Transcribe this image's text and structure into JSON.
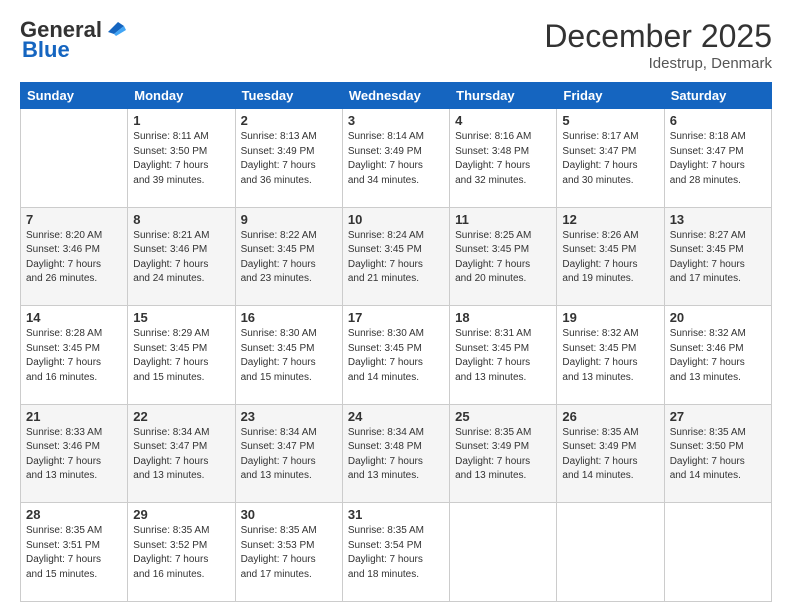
{
  "logo": {
    "general": "General",
    "blue": "Blue"
  },
  "header": {
    "month": "December 2025",
    "location": "Idestrup, Denmark"
  },
  "days": [
    "Sunday",
    "Monday",
    "Tuesday",
    "Wednesday",
    "Thursday",
    "Friday",
    "Saturday"
  ],
  "weeks": [
    [
      {
        "num": "",
        "info": ""
      },
      {
        "num": "1",
        "info": "Sunrise: 8:11 AM\nSunset: 3:50 PM\nDaylight: 7 hours\nand 39 minutes."
      },
      {
        "num": "2",
        "info": "Sunrise: 8:13 AM\nSunset: 3:49 PM\nDaylight: 7 hours\nand 36 minutes."
      },
      {
        "num": "3",
        "info": "Sunrise: 8:14 AM\nSunset: 3:49 PM\nDaylight: 7 hours\nand 34 minutes."
      },
      {
        "num": "4",
        "info": "Sunrise: 8:16 AM\nSunset: 3:48 PM\nDaylight: 7 hours\nand 32 minutes."
      },
      {
        "num": "5",
        "info": "Sunrise: 8:17 AM\nSunset: 3:47 PM\nDaylight: 7 hours\nand 30 minutes."
      },
      {
        "num": "6",
        "info": "Sunrise: 8:18 AM\nSunset: 3:47 PM\nDaylight: 7 hours\nand 28 minutes."
      }
    ],
    [
      {
        "num": "7",
        "info": "Sunrise: 8:20 AM\nSunset: 3:46 PM\nDaylight: 7 hours\nand 26 minutes."
      },
      {
        "num": "8",
        "info": "Sunrise: 8:21 AM\nSunset: 3:46 PM\nDaylight: 7 hours\nand 24 minutes."
      },
      {
        "num": "9",
        "info": "Sunrise: 8:22 AM\nSunset: 3:45 PM\nDaylight: 7 hours\nand 23 minutes."
      },
      {
        "num": "10",
        "info": "Sunrise: 8:24 AM\nSunset: 3:45 PM\nDaylight: 7 hours\nand 21 minutes."
      },
      {
        "num": "11",
        "info": "Sunrise: 8:25 AM\nSunset: 3:45 PM\nDaylight: 7 hours\nand 20 minutes."
      },
      {
        "num": "12",
        "info": "Sunrise: 8:26 AM\nSunset: 3:45 PM\nDaylight: 7 hours\nand 19 minutes."
      },
      {
        "num": "13",
        "info": "Sunrise: 8:27 AM\nSunset: 3:45 PM\nDaylight: 7 hours\nand 17 minutes."
      }
    ],
    [
      {
        "num": "14",
        "info": "Sunrise: 8:28 AM\nSunset: 3:45 PM\nDaylight: 7 hours\nand 16 minutes."
      },
      {
        "num": "15",
        "info": "Sunrise: 8:29 AM\nSunset: 3:45 PM\nDaylight: 7 hours\nand 15 minutes."
      },
      {
        "num": "16",
        "info": "Sunrise: 8:30 AM\nSunset: 3:45 PM\nDaylight: 7 hours\nand 15 minutes."
      },
      {
        "num": "17",
        "info": "Sunrise: 8:30 AM\nSunset: 3:45 PM\nDaylight: 7 hours\nand 14 minutes."
      },
      {
        "num": "18",
        "info": "Sunrise: 8:31 AM\nSunset: 3:45 PM\nDaylight: 7 hours\nand 13 minutes."
      },
      {
        "num": "19",
        "info": "Sunrise: 8:32 AM\nSunset: 3:45 PM\nDaylight: 7 hours\nand 13 minutes."
      },
      {
        "num": "20",
        "info": "Sunrise: 8:32 AM\nSunset: 3:46 PM\nDaylight: 7 hours\nand 13 minutes."
      }
    ],
    [
      {
        "num": "21",
        "info": "Sunrise: 8:33 AM\nSunset: 3:46 PM\nDaylight: 7 hours\nand 13 minutes."
      },
      {
        "num": "22",
        "info": "Sunrise: 8:34 AM\nSunset: 3:47 PM\nDaylight: 7 hours\nand 13 minutes."
      },
      {
        "num": "23",
        "info": "Sunrise: 8:34 AM\nSunset: 3:47 PM\nDaylight: 7 hours\nand 13 minutes."
      },
      {
        "num": "24",
        "info": "Sunrise: 8:34 AM\nSunset: 3:48 PM\nDaylight: 7 hours\nand 13 minutes."
      },
      {
        "num": "25",
        "info": "Sunrise: 8:35 AM\nSunset: 3:49 PM\nDaylight: 7 hours\nand 13 minutes."
      },
      {
        "num": "26",
        "info": "Sunrise: 8:35 AM\nSunset: 3:49 PM\nDaylight: 7 hours\nand 14 minutes."
      },
      {
        "num": "27",
        "info": "Sunrise: 8:35 AM\nSunset: 3:50 PM\nDaylight: 7 hours\nand 14 minutes."
      }
    ],
    [
      {
        "num": "28",
        "info": "Sunrise: 8:35 AM\nSunset: 3:51 PM\nDaylight: 7 hours\nand 15 minutes."
      },
      {
        "num": "29",
        "info": "Sunrise: 8:35 AM\nSunset: 3:52 PM\nDaylight: 7 hours\nand 16 minutes."
      },
      {
        "num": "30",
        "info": "Sunrise: 8:35 AM\nSunset: 3:53 PM\nDaylight: 7 hours\nand 17 minutes."
      },
      {
        "num": "31",
        "info": "Sunrise: 8:35 AM\nSunset: 3:54 PM\nDaylight: 7 hours\nand 18 minutes."
      },
      {
        "num": "",
        "info": ""
      },
      {
        "num": "",
        "info": ""
      },
      {
        "num": "",
        "info": ""
      }
    ]
  ]
}
